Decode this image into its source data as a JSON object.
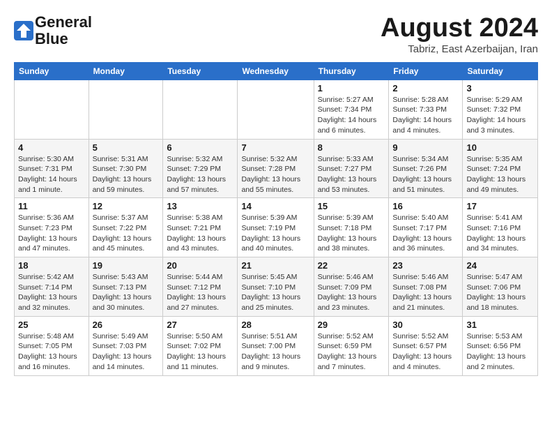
{
  "header": {
    "logo_line1": "General",
    "logo_line2": "Blue",
    "month_year": "August 2024",
    "location": "Tabriz, East Azerbaijan, Iran"
  },
  "days_of_week": [
    "Sunday",
    "Monday",
    "Tuesday",
    "Wednesday",
    "Thursday",
    "Friday",
    "Saturday"
  ],
  "weeks": [
    [
      {
        "day": "",
        "detail": ""
      },
      {
        "day": "",
        "detail": ""
      },
      {
        "day": "",
        "detail": ""
      },
      {
        "day": "",
        "detail": ""
      },
      {
        "day": "1",
        "detail": "Sunrise: 5:27 AM\nSunset: 7:34 PM\nDaylight: 14 hours\nand 6 minutes."
      },
      {
        "day": "2",
        "detail": "Sunrise: 5:28 AM\nSunset: 7:33 PM\nDaylight: 14 hours\nand 4 minutes."
      },
      {
        "day": "3",
        "detail": "Sunrise: 5:29 AM\nSunset: 7:32 PM\nDaylight: 14 hours\nand 3 minutes."
      }
    ],
    [
      {
        "day": "4",
        "detail": "Sunrise: 5:30 AM\nSunset: 7:31 PM\nDaylight: 14 hours\nand 1 minute."
      },
      {
        "day": "5",
        "detail": "Sunrise: 5:31 AM\nSunset: 7:30 PM\nDaylight: 13 hours\nand 59 minutes."
      },
      {
        "day": "6",
        "detail": "Sunrise: 5:32 AM\nSunset: 7:29 PM\nDaylight: 13 hours\nand 57 minutes."
      },
      {
        "day": "7",
        "detail": "Sunrise: 5:32 AM\nSunset: 7:28 PM\nDaylight: 13 hours\nand 55 minutes."
      },
      {
        "day": "8",
        "detail": "Sunrise: 5:33 AM\nSunset: 7:27 PM\nDaylight: 13 hours\nand 53 minutes."
      },
      {
        "day": "9",
        "detail": "Sunrise: 5:34 AM\nSunset: 7:26 PM\nDaylight: 13 hours\nand 51 minutes."
      },
      {
        "day": "10",
        "detail": "Sunrise: 5:35 AM\nSunset: 7:24 PM\nDaylight: 13 hours\nand 49 minutes."
      }
    ],
    [
      {
        "day": "11",
        "detail": "Sunrise: 5:36 AM\nSunset: 7:23 PM\nDaylight: 13 hours\nand 47 minutes."
      },
      {
        "day": "12",
        "detail": "Sunrise: 5:37 AM\nSunset: 7:22 PM\nDaylight: 13 hours\nand 45 minutes."
      },
      {
        "day": "13",
        "detail": "Sunrise: 5:38 AM\nSunset: 7:21 PM\nDaylight: 13 hours\nand 43 minutes."
      },
      {
        "day": "14",
        "detail": "Sunrise: 5:39 AM\nSunset: 7:19 PM\nDaylight: 13 hours\nand 40 minutes."
      },
      {
        "day": "15",
        "detail": "Sunrise: 5:39 AM\nSunset: 7:18 PM\nDaylight: 13 hours\nand 38 minutes."
      },
      {
        "day": "16",
        "detail": "Sunrise: 5:40 AM\nSunset: 7:17 PM\nDaylight: 13 hours\nand 36 minutes."
      },
      {
        "day": "17",
        "detail": "Sunrise: 5:41 AM\nSunset: 7:16 PM\nDaylight: 13 hours\nand 34 minutes."
      }
    ],
    [
      {
        "day": "18",
        "detail": "Sunrise: 5:42 AM\nSunset: 7:14 PM\nDaylight: 13 hours\nand 32 minutes."
      },
      {
        "day": "19",
        "detail": "Sunrise: 5:43 AM\nSunset: 7:13 PM\nDaylight: 13 hours\nand 30 minutes."
      },
      {
        "day": "20",
        "detail": "Sunrise: 5:44 AM\nSunset: 7:12 PM\nDaylight: 13 hours\nand 27 minutes."
      },
      {
        "day": "21",
        "detail": "Sunrise: 5:45 AM\nSunset: 7:10 PM\nDaylight: 13 hours\nand 25 minutes."
      },
      {
        "day": "22",
        "detail": "Sunrise: 5:46 AM\nSunset: 7:09 PM\nDaylight: 13 hours\nand 23 minutes."
      },
      {
        "day": "23",
        "detail": "Sunrise: 5:46 AM\nSunset: 7:08 PM\nDaylight: 13 hours\nand 21 minutes."
      },
      {
        "day": "24",
        "detail": "Sunrise: 5:47 AM\nSunset: 7:06 PM\nDaylight: 13 hours\nand 18 minutes."
      }
    ],
    [
      {
        "day": "25",
        "detail": "Sunrise: 5:48 AM\nSunset: 7:05 PM\nDaylight: 13 hours\nand 16 minutes."
      },
      {
        "day": "26",
        "detail": "Sunrise: 5:49 AM\nSunset: 7:03 PM\nDaylight: 13 hours\nand 14 minutes."
      },
      {
        "day": "27",
        "detail": "Sunrise: 5:50 AM\nSunset: 7:02 PM\nDaylight: 13 hours\nand 11 minutes."
      },
      {
        "day": "28",
        "detail": "Sunrise: 5:51 AM\nSunset: 7:00 PM\nDaylight: 13 hours\nand 9 minutes."
      },
      {
        "day": "29",
        "detail": "Sunrise: 5:52 AM\nSunset: 6:59 PM\nDaylight: 13 hours\nand 7 minutes."
      },
      {
        "day": "30",
        "detail": "Sunrise: 5:52 AM\nSunset: 6:57 PM\nDaylight: 13 hours\nand 4 minutes."
      },
      {
        "day": "31",
        "detail": "Sunrise: 5:53 AM\nSunset: 6:56 PM\nDaylight: 13 hours\nand 2 minutes."
      }
    ]
  ]
}
